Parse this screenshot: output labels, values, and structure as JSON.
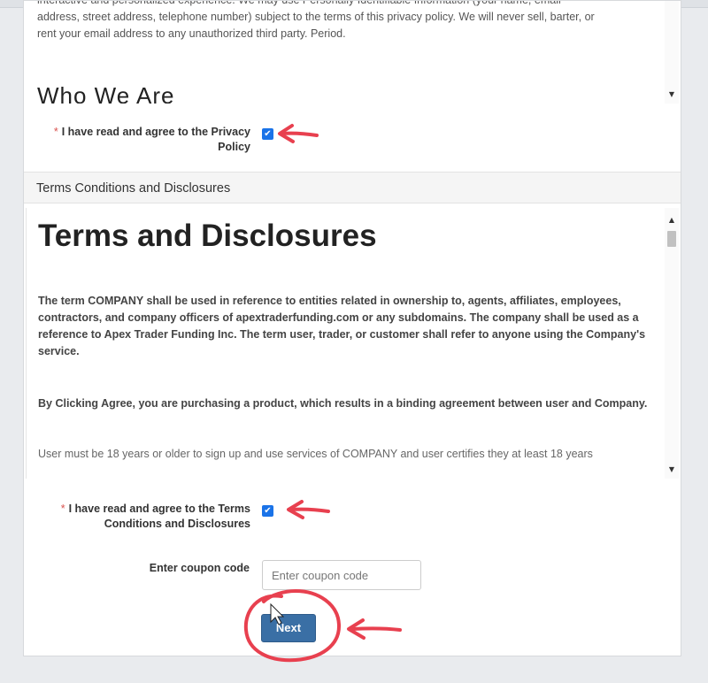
{
  "privacy": {
    "text_line1": "interactive and personalized experience. We may use Personally Identifiable Information (your name, email",
    "text_line2": "address, street address, telephone number) subject to the terms of this privacy policy. We will never sell, barter, or",
    "text_line3": "rent your email address to any unauthorized third party. Period.",
    "next_heading": "Who We Are",
    "agree_label": "I have read and agree to the Privacy Policy",
    "agree_checked": true
  },
  "terms": {
    "section_header": "Terms Conditions and Disclosures",
    "title": "Terms and Disclosures",
    "p1": "The term COMPANY shall be used in reference to entities related in ownership to, agents, affiliates, employees, contractors, and company officers of apextraderfunding.com or any subdomains.  The company shall be used as a reference to Apex Trader Funding Inc.  The term user, trader, or customer shall refer to anyone using the Company's service.",
    "p2": "By Clicking Agree, you are purchasing a product, which results in a binding agreement between user and Company.",
    "p3": "User must be 18 years or older to sign up and use services of COMPANY and user certifies they at least 18 years",
    "agree_label": "I have read and agree to the Terms Conditions and Disclosures",
    "agree_checked": true
  },
  "coupon": {
    "label": "Enter coupon code",
    "placeholder": "Enter coupon code",
    "value": ""
  },
  "next_label": "Next",
  "required_marker": "*",
  "checkmark": "✔",
  "annotation_color": "#e8404f"
}
